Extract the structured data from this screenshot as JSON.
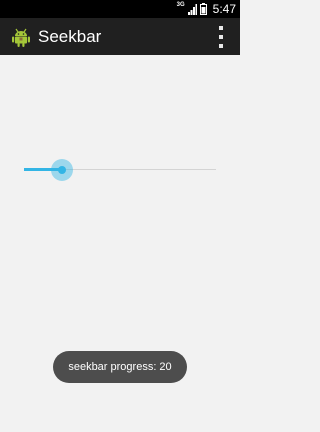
{
  "status_bar": {
    "network_type": "3G",
    "time": "5:47",
    "icons": [
      "signal-icon",
      "battery-icon"
    ]
  },
  "action_bar": {
    "icon": "android-icon",
    "title": "Seekbar",
    "overflow_icon": "more-vert-icon"
  },
  "seekbar": {
    "progress": 20,
    "max": 100,
    "accent_color": "#33b5e5"
  },
  "toast": {
    "text": "seekbar progress: 20"
  }
}
